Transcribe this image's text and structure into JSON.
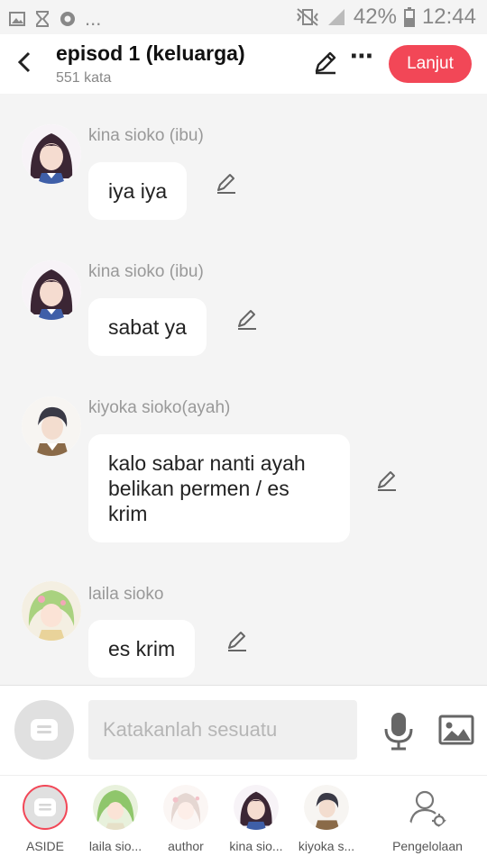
{
  "status_bar": {
    "battery": "42%",
    "time": "12:44",
    "dots": "..."
  },
  "header": {
    "title": "episod 1 (keluarga)",
    "word_count": "551 kata",
    "next_label": "Lanjut"
  },
  "messages": [
    {
      "sender": "kina sioko (ibu)",
      "text": "iya iya"
    },
    {
      "sender": "kina sioko (ibu)",
      "text": "sabat ya"
    },
    {
      "sender": "kiyoka sioko(ayah)",
      "text": "kalo sabar nanti ayah belikan permen / es krim"
    },
    {
      "sender": "laila sioko",
      "text": "es krim"
    }
  ],
  "input": {
    "placeholder": "Katakanlah sesuatu"
  },
  "bottom_bar": {
    "items": [
      {
        "label": "ASIDE"
      },
      {
        "label": "laila sio..."
      },
      {
        "label": "author"
      },
      {
        "label": "kina sio..."
      },
      {
        "label": "kiyoka s..."
      },
      {
        "label": "Pengelolaan"
      }
    ]
  },
  "colors": {
    "accent": "#f24757",
    "background": "#f4f4f4",
    "bubble": "#ffffff",
    "muted": "#999999"
  }
}
